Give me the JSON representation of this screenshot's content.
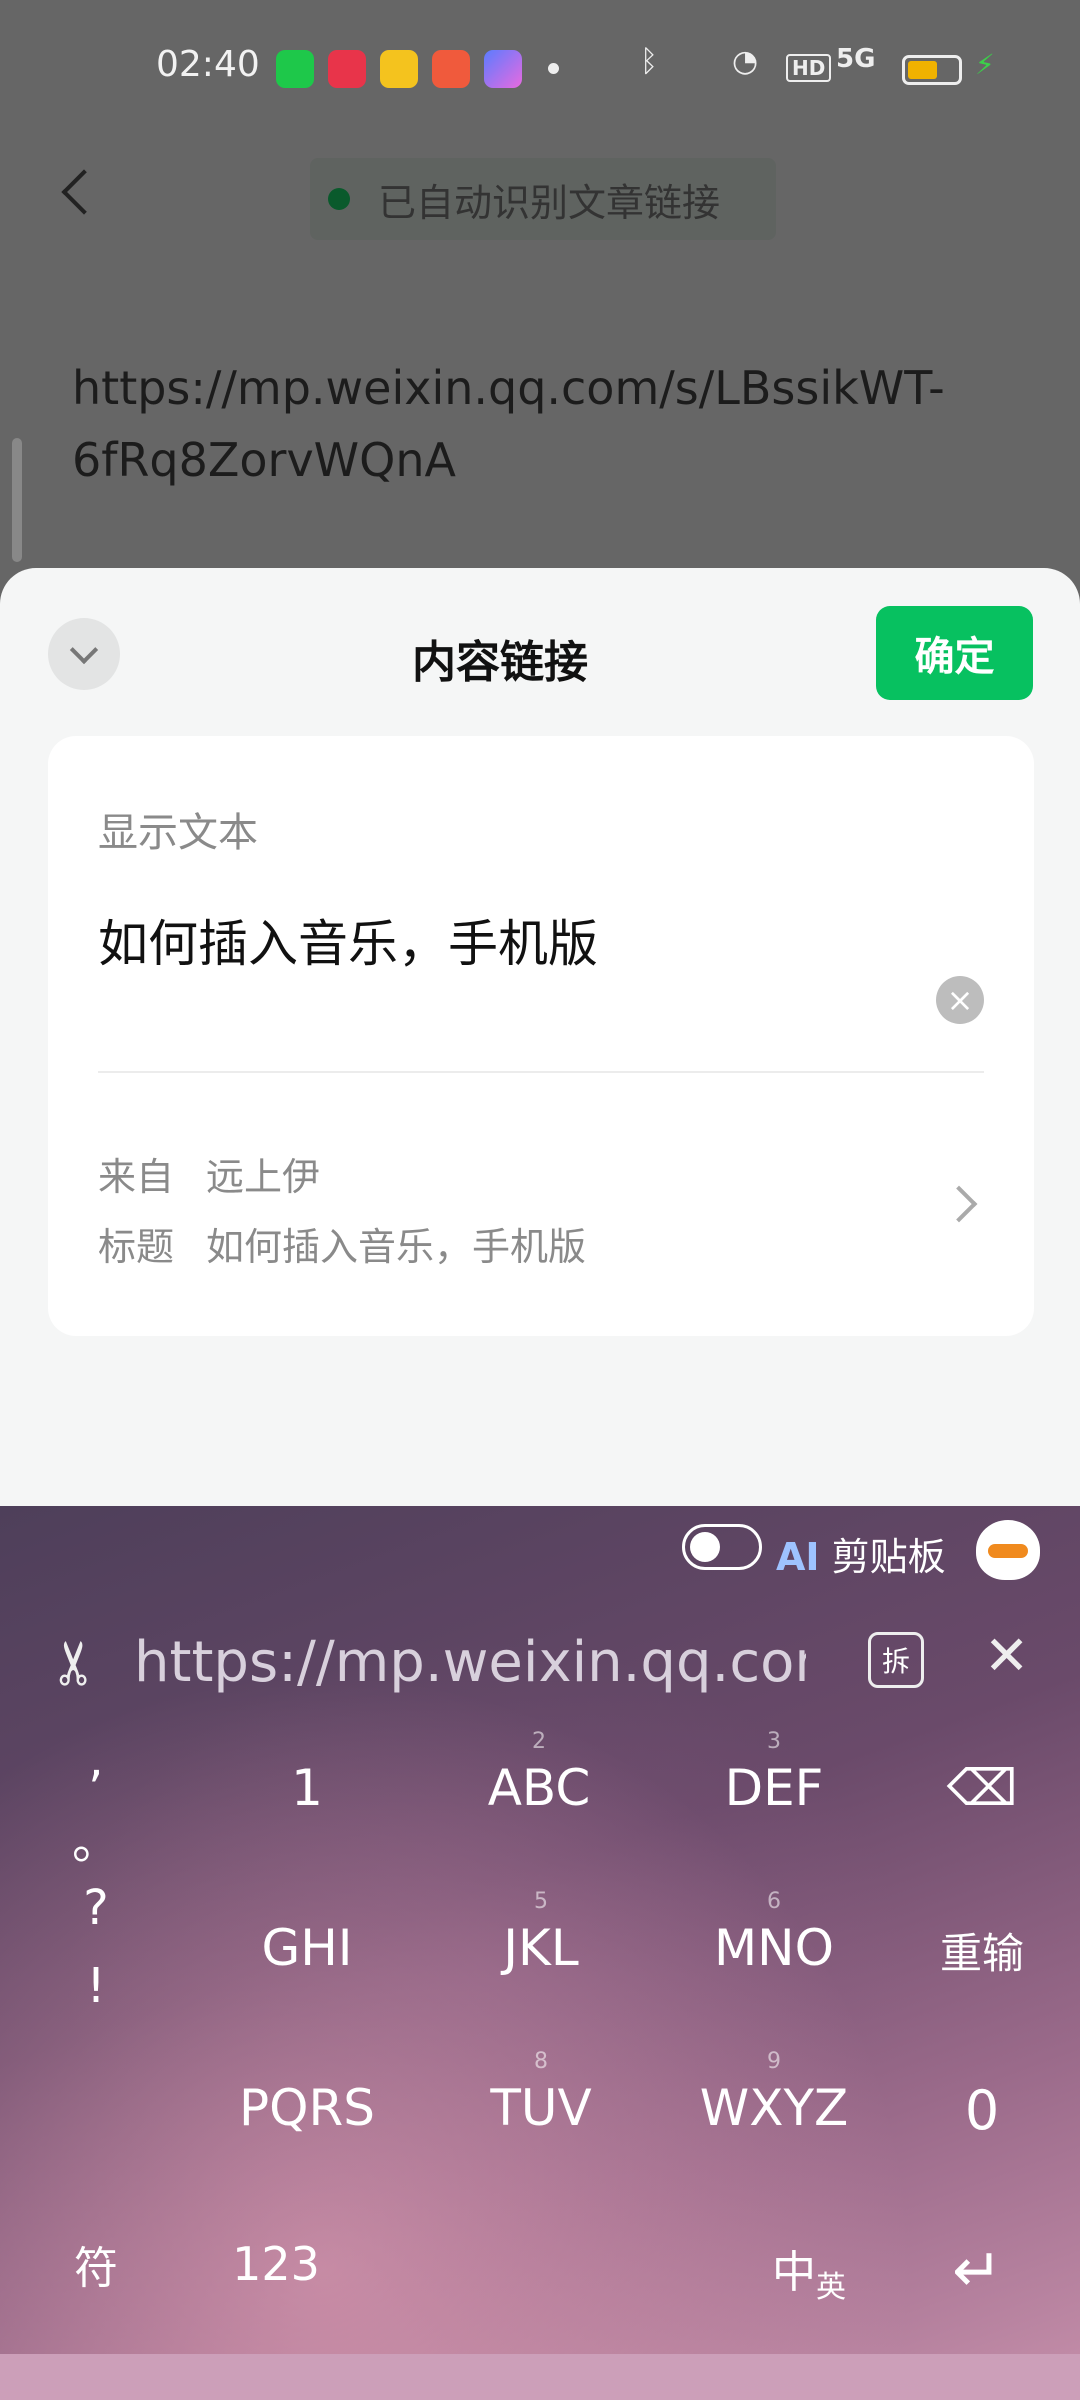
{
  "status_bar": {
    "time": "02:40",
    "apps": [
      "wechat-icon",
      "xiaohongshu-icon",
      "app-icon",
      "pinduoduo-icon",
      "gallery-icon"
    ],
    "indicators": [
      "bluetooth-icon",
      "wifi-icon",
      "hd-icon",
      "signal-icon",
      "battery-icon",
      "charging-icon"
    ],
    "hd_label": "HD",
    "signal_label": "5G",
    "battery_fraction": 0.6
  },
  "header": {
    "back_icon": "chevron-left-icon",
    "auto_detect_text": "已自动识别文章链接"
  },
  "editor": {
    "url": "https://mp.weixin.qq.com/s/LBssikWT-6fRq8ZorvWQnA"
  },
  "sheet": {
    "title": "内容链接",
    "confirm_label": "确定",
    "field_label": "显示文本",
    "field_value": "如何插入音乐，手机版",
    "from_key": "来自",
    "from_value": "远上伊",
    "title_key": "标题",
    "title_value": "如何插入音乐，手机版"
  },
  "keyboard": {
    "ai_label": "AI",
    "clipboard_label": "剪贴板",
    "clip_text": "https://mp.weixin.qq.com",
    "split_label": "拆",
    "punct": [
      ",",
      "。",
      "?",
      "!"
    ],
    "keys": {
      "k1": "1",
      "k2_sub": "2",
      "k2": "ABC",
      "k3_sub": "3",
      "k3": "DEF",
      "k4": "GHI",
      "k5_sub": "5",
      "k5": "JKL",
      "k6_sub": "6",
      "k6": "MNO",
      "k7": "PQRS",
      "k8_sub": "8",
      "k8": "TUV",
      "k9_sub": "9",
      "k9": "WXYZ",
      "reset": "重输",
      "zero": "0",
      "symbol": "符",
      "num": "123",
      "zh": "中",
      "en": "英"
    }
  }
}
